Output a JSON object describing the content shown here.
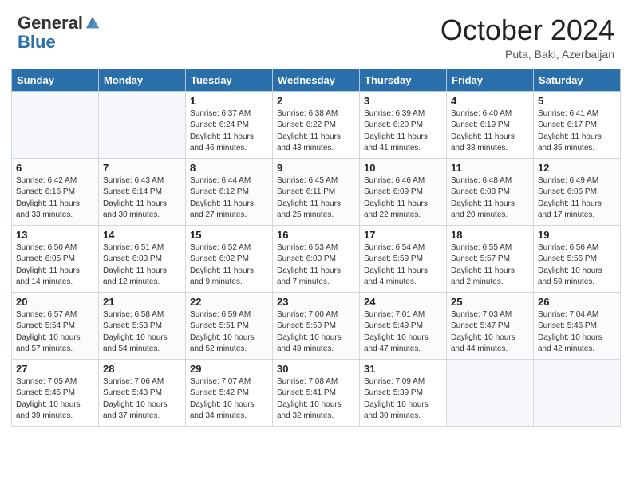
{
  "header": {
    "logo_general": "General",
    "logo_blue": "Blue",
    "month_title": "October 2024",
    "subtitle": "Puta, Baki, Azerbaijan"
  },
  "days_of_week": [
    "Sunday",
    "Monday",
    "Tuesday",
    "Wednesday",
    "Thursday",
    "Friday",
    "Saturday"
  ],
  "weeks": [
    [
      {
        "day": "",
        "detail": ""
      },
      {
        "day": "",
        "detail": ""
      },
      {
        "day": "1",
        "detail": "Sunrise: 6:37 AM\nSunset: 6:24 PM\nDaylight: 11 hours and 46 minutes."
      },
      {
        "day": "2",
        "detail": "Sunrise: 6:38 AM\nSunset: 6:22 PM\nDaylight: 11 hours and 43 minutes."
      },
      {
        "day": "3",
        "detail": "Sunrise: 6:39 AM\nSunset: 6:20 PM\nDaylight: 11 hours and 41 minutes."
      },
      {
        "day": "4",
        "detail": "Sunrise: 6:40 AM\nSunset: 6:19 PM\nDaylight: 11 hours and 38 minutes."
      },
      {
        "day": "5",
        "detail": "Sunrise: 6:41 AM\nSunset: 6:17 PM\nDaylight: 11 hours and 35 minutes."
      }
    ],
    [
      {
        "day": "6",
        "detail": "Sunrise: 6:42 AM\nSunset: 6:16 PM\nDaylight: 11 hours and 33 minutes."
      },
      {
        "day": "7",
        "detail": "Sunrise: 6:43 AM\nSunset: 6:14 PM\nDaylight: 11 hours and 30 minutes."
      },
      {
        "day": "8",
        "detail": "Sunrise: 6:44 AM\nSunset: 6:12 PM\nDaylight: 11 hours and 27 minutes."
      },
      {
        "day": "9",
        "detail": "Sunrise: 6:45 AM\nSunset: 6:11 PM\nDaylight: 11 hours and 25 minutes."
      },
      {
        "day": "10",
        "detail": "Sunrise: 6:46 AM\nSunset: 6:09 PM\nDaylight: 11 hours and 22 minutes."
      },
      {
        "day": "11",
        "detail": "Sunrise: 6:48 AM\nSunset: 6:08 PM\nDaylight: 11 hours and 20 minutes."
      },
      {
        "day": "12",
        "detail": "Sunrise: 6:49 AM\nSunset: 6:06 PM\nDaylight: 11 hours and 17 minutes."
      }
    ],
    [
      {
        "day": "13",
        "detail": "Sunrise: 6:50 AM\nSunset: 6:05 PM\nDaylight: 11 hours and 14 minutes."
      },
      {
        "day": "14",
        "detail": "Sunrise: 6:51 AM\nSunset: 6:03 PM\nDaylight: 11 hours and 12 minutes."
      },
      {
        "day": "15",
        "detail": "Sunrise: 6:52 AM\nSunset: 6:02 PM\nDaylight: 11 hours and 9 minutes."
      },
      {
        "day": "16",
        "detail": "Sunrise: 6:53 AM\nSunset: 6:00 PM\nDaylight: 11 hours and 7 minutes."
      },
      {
        "day": "17",
        "detail": "Sunrise: 6:54 AM\nSunset: 5:59 PM\nDaylight: 11 hours and 4 minutes."
      },
      {
        "day": "18",
        "detail": "Sunrise: 6:55 AM\nSunset: 5:57 PM\nDaylight: 11 hours and 2 minutes."
      },
      {
        "day": "19",
        "detail": "Sunrise: 6:56 AM\nSunset: 5:56 PM\nDaylight: 10 hours and 59 minutes."
      }
    ],
    [
      {
        "day": "20",
        "detail": "Sunrise: 6:57 AM\nSunset: 5:54 PM\nDaylight: 10 hours and 57 minutes."
      },
      {
        "day": "21",
        "detail": "Sunrise: 6:58 AM\nSunset: 5:53 PM\nDaylight: 10 hours and 54 minutes."
      },
      {
        "day": "22",
        "detail": "Sunrise: 6:59 AM\nSunset: 5:51 PM\nDaylight: 10 hours and 52 minutes."
      },
      {
        "day": "23",
        "detail": "Sunrise: 7:00 AM\nSunset: 5:50 PM\nDaylight: 10 hours and 49 minutes."
      },
      {
        "day": "24",
        "detail": "Sunrise: 7:01 AM\nSunset: 5:49 PM\nDaylight: 10 hours and 47 minutes."
      },
      {
        "day": "25",
        "detail": "Sunrise: 7:03 AM\nSunset: 5:47 PM\nDaylight: 10 hours and 44 minutes."
      },
      {
        "day": "26",
        "detail": "Sunrise: 7:04 AM\nSunset: 5:46 PM\nDaylight: 10 hours and 42 minutes."
      }
    ],
    [
      {
        "day": "27",
        "detail": "Sunrise: 7:05 AM\nSunset: 5:45 PM\nDaylight: 10 hours and 39 minutes."
      },
      {
        "day": "28",
        "detail": "Sunrise: 7:06 AM\nSunset: 5:43 PM\nDaylight: 10 hours and 37 minutes."
      },
      {
        "day": "29",
        "detail": "Sunrise: 7:07 AM\nSunset: 5:42 PM\nDaylight: 10 hours and 34 minutes."
      },
      {
        "day": "30",
        "detail": "Sunrise: 7:08 AM\nSunset: 5:41 PM\nDaylight: 10 hours and 32 minutes."
      },
      {
        "day": "31",
        "detail": "Sunrise: 7:09 AM\nSunset: 5:39 PM\nDaylight: 10 hours and 30 minutes."
      },
      {
        "day": "",
        "detail": ""
      },
      {
        "day": "",
        "detail": ""
      }
    ]
  ]
}
